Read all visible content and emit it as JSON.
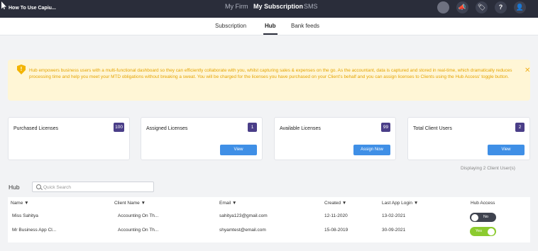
{
  "topbar": {
    "app_title": "How To Use Capiu...",
    "nav": [
      "My Firm",
      "My Subscription",
      "SMS"
    ],
    "icons": [
      "status-dot-icon",
      "megaphone-icon",
      "tag-icon",
      "help-icon",
      "user-icon"
    ],
    "icon_glyphs": [
      "",
      "📣",
      "🏷",
      "?",
      "👤"
    ]
  },
  "subnav": {
    "tabs": [
      "Subscription",
      "Hub",
      "Bank feeds"
    ]
  },
  "alert": {
    "message": "Hub empowers business users with a multi-functional dashboard so they can efficiently collaborate with you, whilst capturing sales & expenses on the go. As the accountant, data is captured and stored in real-time, which dramatically reduces processing time and help you meet your MTD obligations without breaking a sweat. You will be charged for the licenses you have purchased on your Client's behalf and you can assign licenses to Clients using the Hub Access' toggle button.",
    "shield_glyph": "!",
    "close_glyph": "✕"
  },
  "cards": [
    {
      "label": "Purchased Licenses",
      "badge": "100",
      "button": ""
    },
    {
      "label": "Assigned Licenses",
      "badge": "1",
      "button": "View"
    },
    {
      "label": "Available Licenses",
      "badge": "99",
      "button": "Assign Now"
    },
    {
      "label": "Total Client Users",
      "badge": "2",
      "button": "View"
    }
  ],
  "displaying": "Displaying 2 Client User(s)",
  "hub": {
    "title": "Hub",
    "search_placeholder": "Quick Search"
  },
  "table": {
    "headers": [
      "Name ▼",
      "Client Name ▼",
      "Email ▼",
      "Created ▼",
      "Last App Login ▼",
      "Hub Access"
    ],
    "rows": [
      {
        "name": "Miss Sahitya",
        "client": "Accounting On Th...",
        "email": "sahitya123@gmail.com",
        "created": "12-11-2020",
        "last_login": "13-02-2021",
        "access": "No"
      },
      {
        "name": "Mr Business App Cl...",
        "client": "Accounting On Th...",
        "email": "shyamtest@email.com",
        "created": "15-08-2019",
        "last_login": "30-09-2021",
        "access": "Yes"
      }
    ]
  },
  "colors": {
    "topbar": "#2a2d3a",
    "badge": "#4a3e88",
    "button": "#3f8fe6",
    "alert_text": "#e5a400",
    "toggle_on": "#8ccb2f",
    "toggle_off": "#3f434f"
  }
}
